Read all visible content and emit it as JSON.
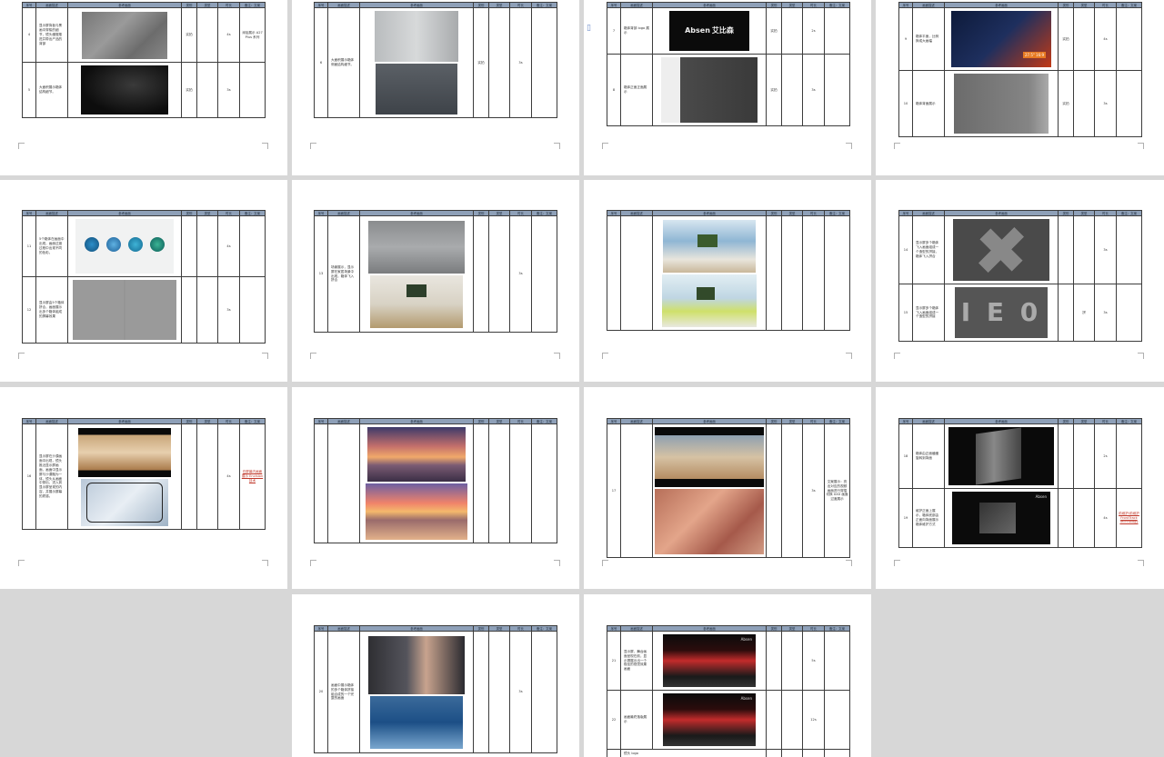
{
  "headers": [
    "序号",
    "画面描述",
    "参考画面",
    "类别",
    "类型",
    "时长",
    "备注：文案"
  ],
  "pages": [
    {
      "rows": [
        {
          "no": "4",
          "desc": "显示屏背板与黑画中穿梭的细节，镜头缓慢推进并带出产品的背部",
          "dur": "4s",
          "type": "实拍",
          "note": "添加展示 A27 Plus 系列"
        },
        {
          "no": "5",
          "desc": "大面积展示箱体结构细节。",
          "dur": "3s",
          "type": "实拍",
          "note": ""
        }
      ]
    },
    {
      "rows": [
        {
          "no": "6",
          "desc": "大面积展示箱体侧面结构细节。",
          "dur": "3s",
          "type": "实拍",
          "note": ""
        }
      ]
    },
    {
      "rows": [
        {
          "no": "7",
          "desc": "箱体背部 logo 展示",
          "dur": "2s",
          "type": "实拍",
          "note": ""
        },
        {
          "no": "8",
          "desc": "箱体正面正面展示",
          "dur": "3s",
          "type": "实拍",
          "note": ""
        }
      ]
    },
    {
      "rows": [
        {
          "no": "9",
          "desc": "箱体平面，比例换成大画幅",
          "dur": "4s",
          "type": "实拍",
          "note": ""
        },
        {
          "no": "10",
          "desc": "箱体背面展示",
          "dur": "3s",
          "type": "实拍",
          "note": ""
        }
      ]
    },
    {
      "rows": [
        {
          "no": "11",
          "desc": "5个箱体在画面中出现，画面过渡过程中出现不同的色彩。",
          "dur": "4s",
          "type": "",
          "note": ""
        },
        {
          "no": "12",
          "desc": "显示屏由5个箱体拼合，画面展示出多个箱体组成的屏幕效果",
          "dur": "3s",
          "type": "",
          "note": ""
        }
      ]
    },
    {
      "rows": [
        {
          "no": "13",
          "desc": "场景展示，显示屏在家居场景中出现，箱体飞入拼合",
          "dur": "3s",
          "type": "",
          "note": ""
        }
      ]
    },
    {
      "rows": [
        {
          "no": "",
          "desc": "",
          "dur": "",
          "type": "",
          "note": ""
        }
      ]
    },
    {
      "rows": [
        {
          "no": "14",
          "desc": "显示屏多个箱体飞入画面组成一个造型的拼接，箱体飞入拼合",
          "dur": "3s",
          "type": "",
          "note": ""
        },
        {
          "no": "15",
          "desc": "显示屏多个箱体飞入画面组成一个造型的拼接",
          "dur": "3s",
          "type": "拼",
          "note": ""
        }
      ]
    },
    {
      "rows": [
        {
          "no": "16",
          "desc": "显示屏在沙漠画面中出现，镜头推近显示屏画面，画面中显示屏与沙漠融为一体，镜头从画面中穿出，进入到显示屏呈现的内容，并展示屏幕的质感。",
          "dur": "4s",
          "type": "",
          "note": "在屏幕内画面展示 Envision 技术"
        }
      ]
    },
    {
      "rows": [
        {
          "no": "",
          "desc": "",
          "dur": "",
          "type": "",
          "note": ""
        }
      ]
    },
    {
      "rows": [
        {
          "no": "17",
          "desc": "",
          "dur": "3s",
          "type": "",
          "note": "文案展示：亮出对应的视频画面进行穿插切换 XXX 画面过渡展示"
        }
      ]
    },
    {
      "rows": [
        {
          "no": "18",
          "desc": "箱体由正面缓缓旋转到背面",
          "dur": "2s",
          "type": "",
          "note": ""
        },
        {
          "no": "19",
          "desc": "维护正面上展示，箱体底部由正面向背面展示箱体维护方式",
          "dur": "4s",
          "type": "",
          "note": "前维护/前维护 FrontTrack Technology"
        }
      ]
    },
    {
      "rows": [
        {
          "no": "20",
          "desc": "画面中展示箱体的多个箱体拼接组合成的一个完整的画面",
          "dur": "3s",
          "type": "",
          "note": ""
        }
      ]
    },
    {
      "rows": [
        {
          "no": "21",
          "desc": "显示屏、舞台画面呈现在前，显示屏展示出一个极佳的视觉效果画面",
          "dur": "5s",
          "type": "",
          "note": ""
        },
        {
          "no": "22",
          "desc": "画面最终落版展示",
          "dur": "12s",
          "type": "",
          "note": ""
        }
      ],
      "footer": "镜头 logo"
    }
  ],
  "logos": {
    "absen": "Absen",
    "absen_cn": "艾比森"
  },
  "overlay": {
    "ratio": "27.5\" 16:9"
  },
  "text_tile": "I E 0"
}
